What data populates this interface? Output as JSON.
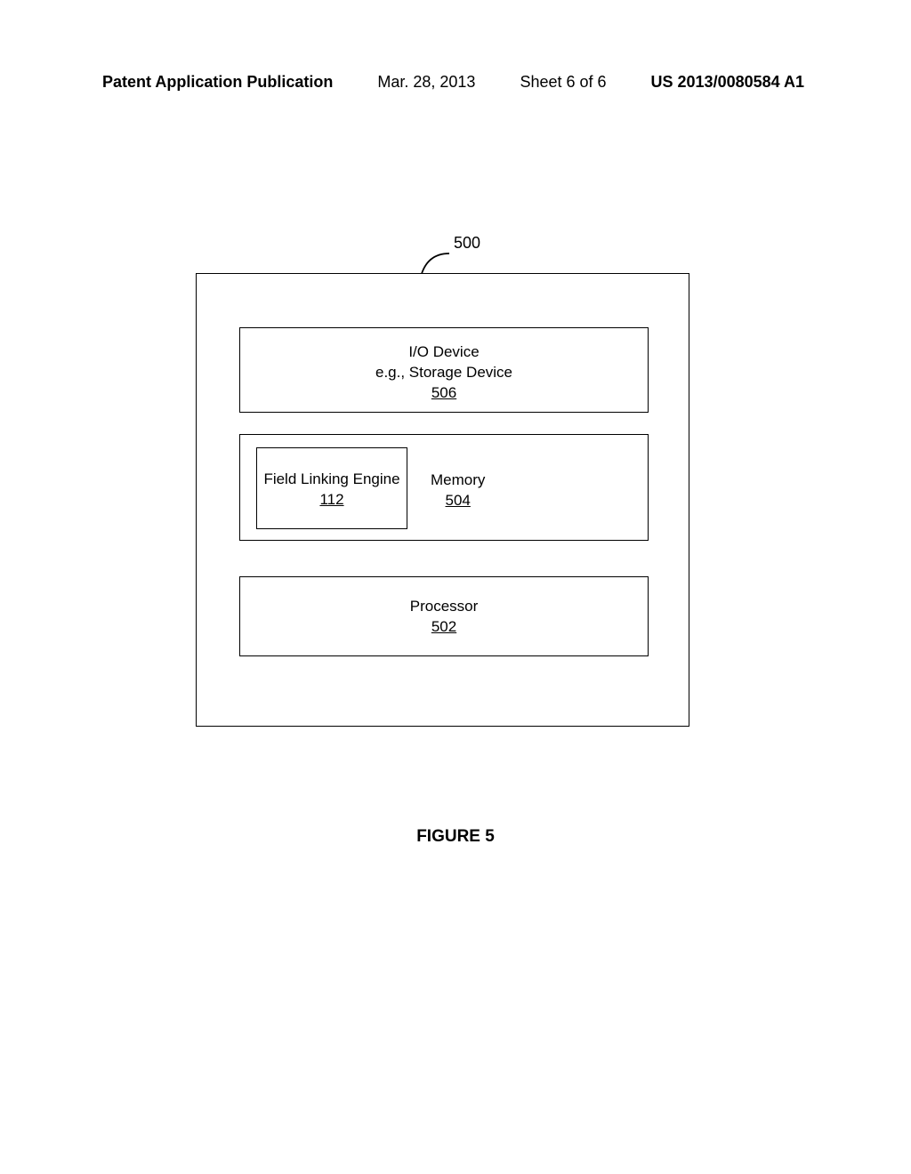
{
  "header": {
    "publication": "Patent Application Publication",
    "date": "Mar. 28, 2013",
    "sheet": "Sheet 6 of 6",
    "docnum": "US 2013/0080584 A1"
  },
  "diagram": {
    "ref_label": "500",
    "io": {
      "line1": "I/O Device",
      "line2": "e.g., Storage Device",
      "ref": "506"
    },
    "memory": {
      "inner_label": "Field Linking Engine",
      "inner_ref": "112",
      "label": "Memory",
      "ref": "504"
    },
    "processor": {
      "label": "Processor",
      "ref": "502"
    }
  },
  "caption": "FIGURE 5"
}
